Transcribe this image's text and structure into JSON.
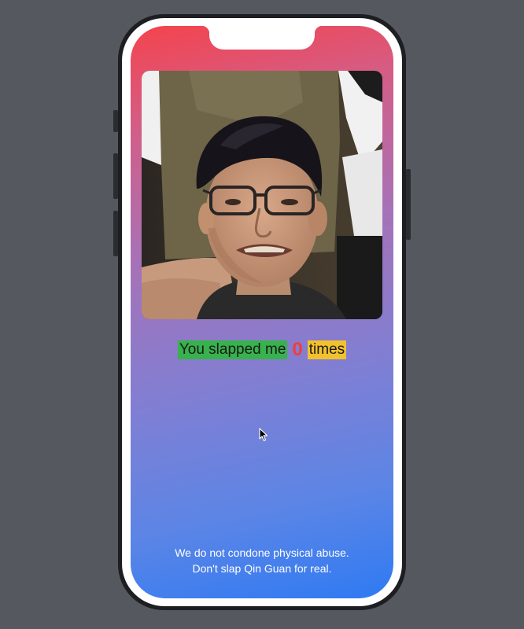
{
  "app": {
    "counter_prefix": "You slapped me",
    "slap_count": "0",
    "counter_suffix": "times",
    "disclaimer_line1": "We do not condone physical abuse.",
    "disclaimer_line2": "Don't slap Qin Guan for real."
  },
  "colors": {
    "background": "#55585e",
    "gradient_top": "#f5434c",
    "gradient_bottom": "#2f7af3",
    "prefix_highlight": "#37b24d",
    "count_color": "#f03e3e",
    "suffix_highlight": "#f2c12e"
  },
  "icons": {
    "cursor": "mouse-pointer-arrow"
  }
}
